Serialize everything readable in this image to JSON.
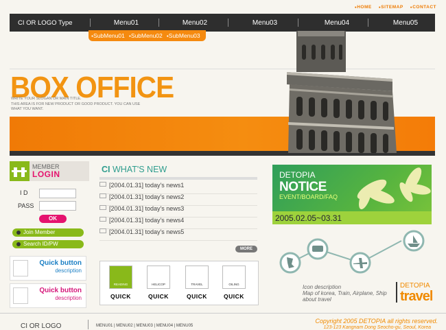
{
  "toplinks": [
    "HOME",
    "SITEMAP",
    "CONTACT"
  ],
  "nav": {
    "logo": "CI OR LOGO Type",
    "items": [
      "Menu01",
      "Menu02",
      "Menu03",
      "Menu04",
      "Menu05"
    ]
  },
  "submenu": [
    "SubMenu01",
    "SubMenu02",
    "SubMenu03"
  ],
  "hero": {
    "title": "BOX OFFICE",
    "slogan": [
      "Write your slogan or main title.",
      "This area is for new product or good product. You can use",
      "what you want."
    ]
  },
  "login": {
    "member": "MEMBER",
    "title": "LOGIN",
    "id_label": "I  D",
    "pass_label": "PASS",
    "ok": "OK",
    "join": "Join Member",
    "search": "Search ID/PW"
  },
  "quick_buttons": [
    {
      "title": "Quick button",
      "desc": "description",
      "color": "#1b7fc4"
    },
    {
      "title": "Quick button",
      "desc": "description",
      "color": "#d5177a"
    }
  ],
  "news": {
    "ci": "CI",
    "title": "WHAT'S NEW",
    "items": [
      "[2004.01.31] today's news1",
      "[2004.01.31] today's news2",
      "[2004.01.31] today's news3",
      "[2004.01.31] today's news4",
      "[2004.01.31] today's news5"
    ],
    "more": "MORE"
  },
  "quick_icons": [
    {
      "icon_label": "READING",
      "label": "QUICK"
    },
    {
      "icon_label": "HELICOP",
      "label": "QUICK"
    },
    {
      "icon_label": "TRAVEL",
      "label": "QUICK"
    },
    {
      "icon_label": "OILING",
      "label": "QUICK"
    }
  ],
  "notice": {
    "brand": "DETOPIA",
    "title": "NOTICE",
    "sub": "EVENT/BOARD/FAQ",
    "date": "2005.02.05~03.31"
  },
  "travel": {
    "desc": [
      "Icon description",
      "Map of korea, Train, Airplane, Ship",
      "about travel"
    ],
    "brand": "DETOPIA",
    "word": "travel"
  },
  "footer": {
    "logo": "CI OR LOGO",
    "menu": "MENU01 | MENU02 | MENU03 | MENU04 | MENU05",
    "copyright": "Copyright 2005 DETOPIA all rights reserved.",
    "address": "123-123 Kangnam Dong Seocho-gu, Seoul, Korea"
  },
  "colors": {
    "orange": "#f29412",
    "green": "#89b91a",
    "pink": "#e5136e",
    "teal": "#2f9d8e"
  }
}
